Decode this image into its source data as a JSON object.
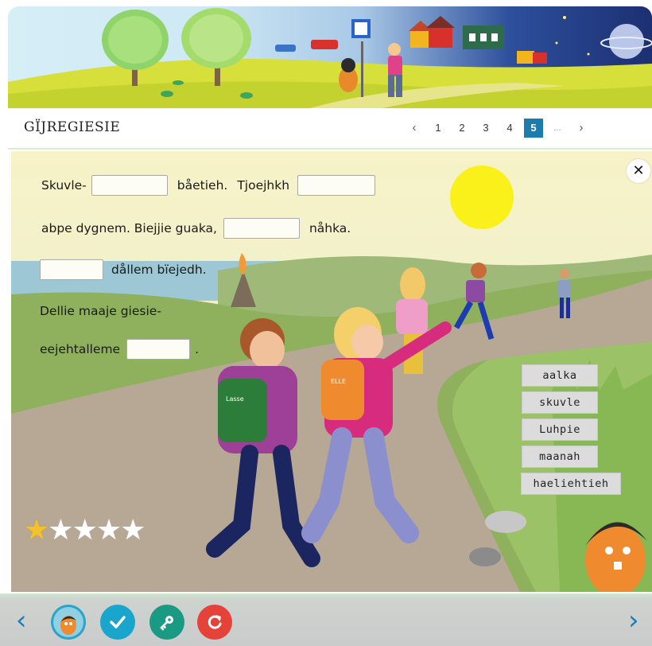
{
  "header": {
    "title": "GÏJREGIESIE",
    "pagination": {
      "prev": "‹",
      "pages": [
        "1",
        "2",
        "3",
        "4",
        "5"
      ],
      "current": "5",
      "ellipsis": "...",
      "next": "›"
    }
  },
  "exercise": {
    "close": "✕",
    "sentence": {
      "part1": "Skuvle-",
      "part2": "båetieh.",
      "part3": "Tjoejhkh",
      "part4": "abpe dygnem. Biejjie guaka,",
      "part5": "nåhka.",
      "part6": "dållem bïejedh.",
      "part7": "Dellie maaje giesie-",
      "part8": "eejehtalleme",
      "part9": "."
    },
    "word_bank": [
      "aalka",
      "skuvle",
      "Luhpie",
      "maanah",
      "haeliehtieh"
    ],
    "rating": {
      "score": 1,
      "max": 5,
      "star": "★"
    },
    "backpack_labels": {
      "left": "Lasse",
      "right": "ELLE"
    }
  },
  "footer": {
    "prev_arrow": "‹",
    "next_arrow": "›",
    "buttons": [
      {
        "name": "mascot-button",
        "icon": "mascot-icon",
        "color": "#2ca3c8"
      },
      {
        "name": "check-button",
        "icon": "check-icon",
        "color": "#1aa5cc"
      },
      {
        "name": "key-button",
        "icon": "key-icon",
        "color": "#1b9a83"
      },
      {
        "name": "restart-button",
        "icon": "restart-icon",
        "color": "#e5433a"
      }
    ]
  }
}
